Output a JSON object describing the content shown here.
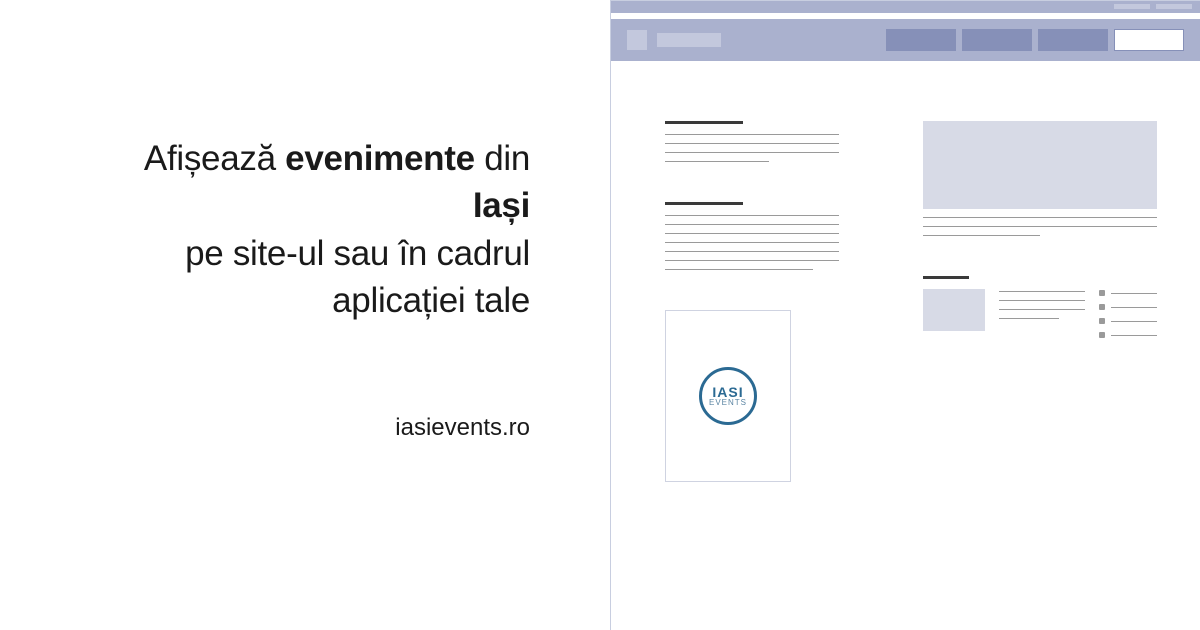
{
  "headline": {
    "part1": "Afișează ",
    "bold1": "evenimente",
    "part2": " din ",
    "bold2": "Iași",
    "line2": "pe site-ul sau în cadrul",
    "line3": "aplicației tale"
  },
  "site": "iasievents.ro",
  "logo": {
    "top": "IASI",
    "bot": "EVENTS"
  }
}
